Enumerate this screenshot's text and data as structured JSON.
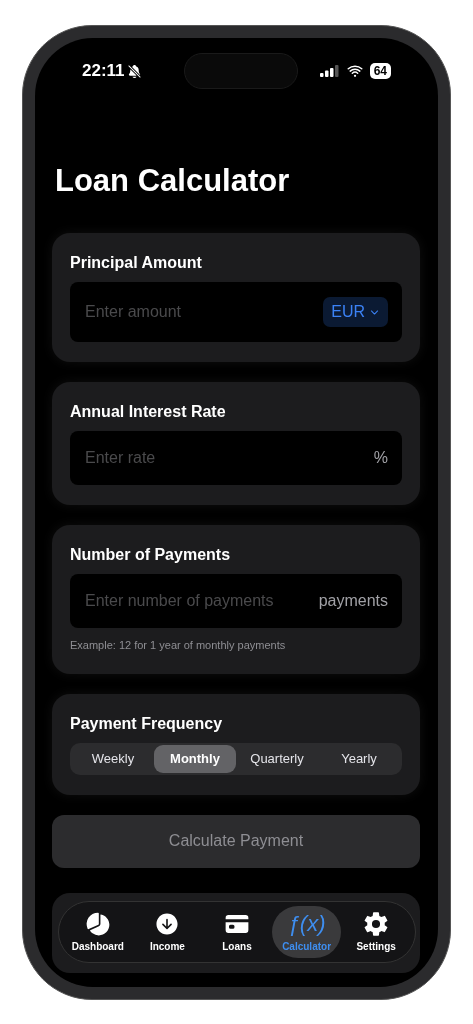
{
  "status_bar": {
    "time": "22:11",
    "silent": true,
    "battery": "64"
  },
  "title": "Loan Calculator",
  "fields": [
    {
      "kind": "currency",
      "label": "Principal Amount",
      "placeholder": "Enter amount",
      "suffix": "EUR"
    },
    {
      "kind": "unit",
      "label": "Annual Interest Rate",
      "placeholder": "Enter rate",
      "suffix": "%"
    },
    {
      "kind": "unit",
      "label": "Number of Payments",
      "placeholder": "Enter number of payments",
      "suffix": "payments",
      "hint": "Example: 12 for 1 year of monthly payments"
    }
  ],
  "frequency": {
    "label": "Payment Frequency",
    "options": [
      {
        "label": "Weekly",
        "selected": false
      },
      {
        "label": "Monthly",
        "selected": true
      },
      {
        "label": "Quarterly",
        "selected": false
      },
      {
        "label": "Yearly",
        "selected": false
      }
    ]
  },
  "calculate_button": {
    "label": "Calculate Payment",
    "disabled": true
  },
  "tab_bar": [
    {
      "kind": "pie",
      "label": "Dashboard",
      "selected": false
    },
    {
      "kind": "income",
      "label": "Income",
      "selected": false
    },
    {
      "kind": "card",
      "label": "Loans",
      "selected": false
    },
    {
      "kind": "function",
      "label": "Calculator",
      "glyph": "ƒ(x)",
      "selected": true
    },
    {
      "kind": "gear",
      "label": "Settings",
      "selected": false
    }
  ]
}
